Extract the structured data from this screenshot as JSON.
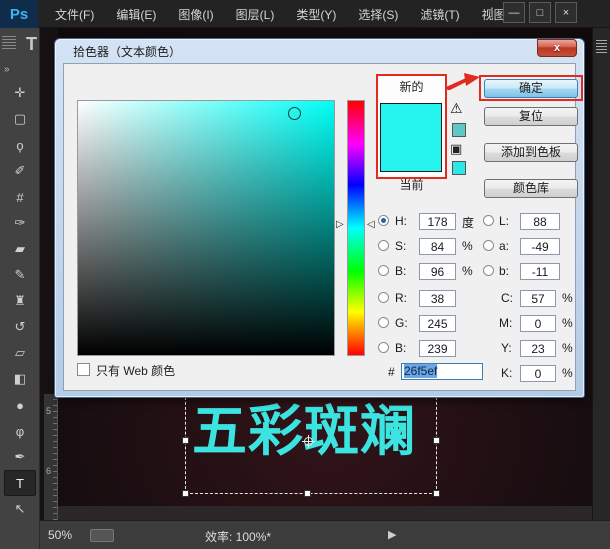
{
  "menu_bar": {
    "logo": "Ps",
    "items": [
      "文件(F)",
      "编辑(E)",
      "图像(I)",
      "图层(L)",
      "类型(Y)",
      "选择(S)",
      "滤镜(T)",
      "视图(V)"
    ],
    "overflow": "⋮",
    "window_controls": {
      "minimize": "—",
      "maximize": "□",
      "close": "×"
    }
  },
  "toolbar": {
    "collapse": "»",
    "options_type_icon": "T",
    "tools": [
      {
        "name": "move-tool",
        "glyph": "✛"
      },
      {
        "name": "marquee-tool",
        "glyph": "▢"
      },
      {
        "name": "lasso-tool",
        "glyph": "ϙ"
      },
      {
        "name": "quick-selection-tool",
        "glyph": "✐"
      },
      {
        "name": "crop-tool",
        "glyph": "#"
      },
      {
        "name": "eyedropper-tool",
        "glyph": "✑"
      },
      {
        "name": "healing-brush-tool",
        "glyph": "▰"
      },
      {
        "name": "brush-tool",
        "glyph": "✎"
      },
      {
        "name": "clone-stamp-tool",
        "glyph": "♜"
      },
      {
        "name": "history-brush-tool",
        "glyph": "↺"
      },
      {
        "name": "eraser-tool",
        "glyph": "▱"
      },
      {
        "name": "paint-bucket-tool",
        "glyph": "◧"
      },
      {
        "name": "blur-tool",
        "glyph": "●"
      },
      {
        "name": "dodge-tool",
        "glyph": "φ"
      },
      {
        "name": "pen-tool",
        "glyph": "✒"
      },
      {
        "name": "type-tool",
        "glyph": "T"
      },
      {
        "name": "path-selection-tool",
        "glyph": "↖"
      }
    ]
  },
  "dialog": {
    "title": "拾色器（文本颜色）",
    "close_glyph": "x",
    "labels": {
      "new": "新的",
      "current": "当前",
      "only_web": "只有 Web 颜色",
      "hex_prefix": "#"
    },
    "buttons": {
      "ok": "确定",
      "reset": "复位",
      "add_to_swatches": "添加到色板",
      "color_libraries": "颜色库"
    },
    "left_fields": [
      {
        "label": "H:",
        "value": "178",
        "unit": "度"
      },
      {
        "label": "S:",
        "value": "84",
        "unit": "%"
      },
      {
        "label": "B:",
        "value": "96",
        "unit": "%"
      },
      {
        "label": "R:",
        "value": "38",
        "unit": ""
      },
      {
        "label": "G:",
        "value": "245",
        "unit": ""
      },
      {
        "label": "B:",
        "value": "239",
        "unit": ""
      }
    ],
    "right_fields": [
      {
        "label": "L:",
        "value": "88",
        "unit": ""
      },
      {
        "label": "a:",
        "value": "-49",
        "unit": ""
      },
      {
        "label": "b:",
        "value": "-11",
        "unit": ""
      },
      {
        "label": "C:",
        "value": "57",
        "unit": "%"
      },
      {
        "label": "M:",
        "value": "0",
        "unit": "%"
      },
      {
        "label": "Y:",
        "value": "23",
        "unit": "%"
      },
      {
        "label": "K:",
        "value": "0",
        "unit": "%"
      }
    ],
    "hex_value": "26f5ef",
    "colors": {
      "new_color": "#26f5ef",
      "current_color": "#26f5ef",
      "annotation_red": "#e02b20"
    },
    "hue_arrow_left": "▷",
    "hue_arrow_right": "◁",
    "gamut_warning_glyph": "⚠",
    "web_cube_glyph": "▣"
  },
  "canvas": {
    "text": "五彩斑斓",
    "text_color": "#3be4e0"
  },
  "ruler": {
    "mark1": "5",
    "mark2": "6"
  },
  "status_bar": {
    "zoom": "50%",
    "efficiency": "效率: 100%*",
    "arrow": "▶"
  }
}
